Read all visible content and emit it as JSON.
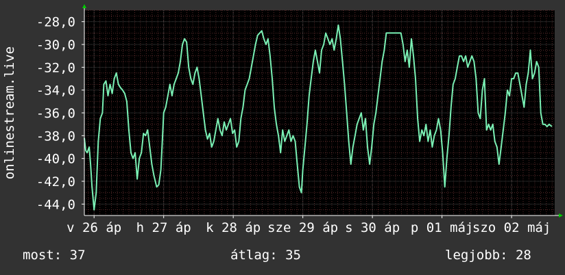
{
  "chart_data": {
    "type": "line",
    "ylabel": "onlinestream.live",
    "ylim": [
      -45,
      -27
    ],
    "y_ticks": [
      "-28,0",
      "-30,0",
      "-32,0",
      "-34,0",
      "-36,0",
      "-38,0",
      "-40,0",
      "-42,0",
      "-44,0"
    ],
    "y_tick_values": [
      -28,
      -30,
      -32,
      -34,
      -36,
      -38,
      -40,
      -42,
      -44
    ],
    "x_ticks": [
      "v 26 áp",
      "h 27 áp",
      "k 28 áp",
      "sze 29 áp",
      "s 30 áp",
      "p 01 máj",
      "szo 02 máj"
    ],
    "x_tick_values": [
      0,
      1,
      2,
      3,
      4,
      5,
      6
    ],
    "xlim": [
      -0.14,
      6.62
    ],
    "grid": true,
    "colors": {
      "background": "#000000",
      "frame": "#323232",
      "grid_major": "#3a3a3a",
      "grid_minor": "#5a2a2a",
      "line": "#7af0b4",
      "axis": "#ffffff",
      "arrow": "#00cc00"
    },
    "series": [
      {
        "values": [
          [
            -0.14,
            -38.2
          ],
          [
            -0.12,
            -39.3
          ],
          [
            -0.1,
            -39.5
          ],
          [
            -0.07,
            -39.0
          ],
          [
            -0.05,
            -40.5
          ],
          [
            -0.03,
            -42.5
          ],
          [
            0.0,
            -44.5
          ],
          [
            0.03,
            -43.0
          ],
          [
            0.06,
            -38.5
          ],
          [
            0.09,
            -36.5
          ],
          [
            0.12,
            -36.0
          ],
          [
            0.14,
            -33.5
          ],
          [
            0.17,
            -33.2
          ],
          [
            0.2,
            -34.5
          ],
          [
            0.23,
            -33.5
          ],
          [
            0.26,
            -34.3
          ],
          [
            0.29,
            -33.0
          ],
          [
            0.32,
            -32.5
          ],
          [
            0.35,
            -33.5
          ],
          [
            0.38,
            -33.8
          ],
          [
            0.41,
            -34.0
          ],
          [
            0.44,
            -34.3
          ],
          [
            0.47,
            -35.0
          ],
          [
            0.5,
            -37.5
          ],
          [
            0.53,
            -39.5
          ],
          [
            0.56,
            -40.0
          ],
          [
            0.59,
            -39.5
          ],
          [
            0.62,
            -41.8
          ],
          [
            0.65,
            -40.0
          ],
          [
            0.68,
            -39.5
          ],
          [
            0.71,
            -37.8
          ],
          [
            0.74,
            -38.0
          ],
          [
            0.77,
            -37.5
          ],
          [
            0.8,
            -39.0
          ],
          [
            0.83,
            -40.5
          ],
          [
            0.86,
            -41.5
          ],
          [
            0.9,
            -42.5
          ],
          [
            0.93,
            -42.3
          ],
          [
            0.96,
            -41.0
          ],
          [
            0.98,
            -38.5
          ],
          [
            1.0,
            -36.0
          ],
          [
            1.03,
            -35.5
          ],
          [
            1.06,
            -34.5
          ],
          [
            1.09,
            -33.5
          ],
          [
            1.12,
            -34.5
          ],
          [
            1.15,
            -33.5
          ],
          [
            1.18,
            -33.0
          ],
          [
            1.21,
            -32.5
          ],
          [
            1.24,
            -31.5
          ],
          [
            1.27,
            -30.0
          ],
          [
            1.3,
            -29.5
          ],
          [
            1.33,
            -29.8
          ],
          [
            1.36,
            -32.0
          ],
          [
            1.39,
            -33.0
          ],
          [
            1.42,
            -33.5
          ],
          [
            1.45,
            -32.5
          ],
          [
            1.48,
            -32.0
          ],
          [
            1.51,
            -33.0
          ],
          [
            1.54,
            -34.5
          ],
          [
            1.57,
            -36.0
          ],
          [
            1.6,
            -37.5
          ],
          [
            1.63,
            -38.3
          ],
          [
            1.66,
            -37.8
          ],
          [
            1.69,
            -39.0
          ],
          [
            1.72,
            -38.5
          ],
          [
            1.75,
            -37.5
          ],
          [
            1.78,
            -36.5
          ],
          [
            1.81,
            -37.5
          ],
          [
            1.84,
            -38.0
          ],
          [
            1.87,
            -36.8
          ],
          [
            1.9,
            -37.5
          ],
          [
            1.93,
            -37.0
          ],
          [
            1.96,
            -36.5
          ],
          [
            1.99,
            -37.8
          ],
          [
            2.02,
            -37.5
          ],
          [
            2.05,
            -39.0
          ],
          [
            2.08,
            -38.5
          ],
          [
            2.11,
            -36.5
          ],
          [
            2.14,
            -35.5
          ],
          [
            2.17,
            -34.0
          ],
          [
            2.2,
            -33.5
          ],
          [
            2.23,
            -33.0
          ],
          [
            2.26,
            -32.0
          ],
          [
            2.29,
            -31.0
          ],
          [
            2.32,
            -30.0
          ],
          [
            2.35,
            -29.2
          ],
          [
            2.38,
            -29.0
          ],
          [
            2.41,
            -28.8
          ],
          [
            2.44,
            -29.5
          ],
          [
            2.47,
            -30.0
          ],
          [
            2.5,
            -29.5
          ],
          [
            2.53,
            -31.0
          ],
          [
            2.56,
            -33.0
          ],
          [
            2.59,
            -35.5
          ],
          [
            2.62,
            -37.0
          ],
          [
            2.65,
            -38.0
          ],
          [
            2.68,
            -39.5
          ],
          [
            2.71,
            -37.5
          ],
          [
            2.74,
            -38.5
          ],
          [
            2.77,
            -38.0
          ],
          [
            2.8,
            -37.5
          ],
          [
            2.83,
            -38.5
          ],
          [
            2.86,
            -38.0
          ],
          [
            2.89,
            -38.5
          ],
          [
            2.92,
            -40.5
          ],
          [
            2.95,
            -42.5
          ],
          [
            2.98,
            -43.0
          ],
          [
            3.0,
            -41.0
          ],
          [
            3.03,
            -39.0
          ],
          [
            3.06,
            -37.0
          ],
          [
            3.09,
            -34.5
          ],
          [
            3.12,
            -33.0
          ],
          [
            3.15,
            -31.5
          ],
          [
            3.18,
            -30.5
          ],
          [
            3.21,
            -31.5
          ],
          [
            3.24,
            -32.5
          ],
          [
            3.27,
            -30.5
          ],
          [
            3.3,
            -30.0
          ],
          [
            3.33,
            -29.0
          ],
          [
            3.36,
            -29.5
          ],
          [
            3.39,
            -30.0
          ],
          [
            3.42,
            -29.5
          ],
          [
            3.45,
            -30.5
          ],
          [
            3.48,
            -29.5
          ],
          [
            3.51,
            -28.3
          ],
          [
            3.54,
            -29.5
          ],
          [
            3.57,
            -31.5
          ],
          [
            3.6,
            -33.5
          ],
          [
            3.63,
            -36.0
          ],
          [
            3.66,
            -38.5
          ],
          [
            3.69,
            -40.5
          ],
          [
            3.72,
            -39.0
          ],
          [
            3.75,
            -38.0
          ],
          [
            3.78,
            -37.0
          ],
          [
            3.81,
            -36.5
          ],
          [
            3.84,
            -36.0
          ],
          [
            3.87,
            -37.5
          ],
          [
            3.9,
            -36.5
          ],
          [
            3.93,
            -39.0
          ],
          [
            3.96,
            -40.5
          ],
          [
            3.99,
            -39.0
          ],
          [
            4.02,
            -37.0
          ],
          [
            4.05,
            -36.0
          ],
          [
            4.08,
            -34.5
          ],
          [
            4.11,
            -33.0
          ],
          [
            4.14,
            -31.5
          ],
          [
            4.17,
            -30.5
          ],
          [
            4.2,
            -29.0
          ],
          [
            4.23,
            -29.0
          ],
          [
            4.26,
            -29.0
          ],
          [
            4.29,
            -29.0
          ],
          [
            4.32,
            -29.0
          ],
          [
            4.35,
            -29.0
          ],
          [
            4.38,
            -29.0
          ],
          [
            4.41,
            -29.0
          ],
          [
            4.44,
            -30.0
          ],
          [
            4.47,
            -31.5
          ],
          [
            4.5,
            -30.5
          ],
          [
            4.53,
            -32.0
          ],
          [
            4.56,
            -29.5
          ],
          [
            4.59,
            -31.0
          ],
          [
            4.62,
            -33.0
          ],
          [
            4.65,
            -36.5
          ],
          [
            4.68,
            -38.5
          ],
          [
            4.71,
            -37.5
          ],
          [
            4.74,
            -38.0
          ],
          [
            4.77,
            -37.0
          ],
          [
            4.8,
            -38.5
          ],
          [
            4.83,
            -37.5
          ],
          [
            4.86,
            -39.0
          ],
          [
            4.89,
            -38.0
          ],
          [
            4.92,
            -37.5
          ],
          [
            4.95,
            -36.5
          ],
          [
            4.98,
            -37.5
          ],
          [
            5.01,
            -39.5
          ],
          [
            5.04,
            -42.5
          ],
          [
            5.07,
            -40.0
          ],
          [
            5.1,
            -38.0
          ],
          [
            5.13,
            -35.5
          ],
          [
            5.16,
            -33.5
          ],
          [
            5.19,
            -33.0
          ],
          [
            5.22,
            -32.0
          ],
          [
            5.25,
            -31.0
          ],
          [
            5.28,
            -31.0
          ],
          [
            5.31,
            -31.5
          ],
          [
            5.34,
            -31.0
          ],
          [
            5.37,
            -32.0
          ],
          [
            5.4,
            -31.5
          ],
          [
            5.43,
            -31.0
          ],
          [
            5.46,
            -31.5
          ],
          [
            5.49,
            -33.0
          ],
          [
            5.52,
            -36.0
          ],
          [
            5.55,
            -36.5
          ],
          [
            5.58,
            -34.0
          ],
          [
            5.61,
            -33.0
          ],
          [
            5.64,
            -37.5
          ],
          [
            5.67,
            -37.0
          ],
          [
            5.7,
            -37.5
          ],
          [
            5.73,
            -37.0
          ],
          [
            5.76,
            -38.5
          ],
          [
            5.79,
            -39.0
          ],
          [
            5.82,
            -40.5
          ],
          [
            5.85,
            -39.0
          ],
          [
            5.88,
            -37.5
          ],
          [
            5.91,
            -36.0
          ],
          [
            5.94,
            -34.0
          ],
          [
            5.97,
            -34.5
          ],
          [
            6.0,
            -33.0
          ],
          [
            6.03,
            -33.0
          ],
          [
            6.06,
            -32.5
          ],
          [
            6.09,
            -32.5
          ],
          [
            6.12,
            -33.5
          ],
          [
            6.15,
            -34.5
          ],
          [
            6.18,
            -35.5
          ],
          [
            6.21,
            -33.5
          ],
          [
            6.24,
            -32.5
          ],
          [
            6.27,
            -30.5
          ],
          [
            6.3,
            -33.0
          ],
          [
            6.33,
            -32.5
          ],
          [
            6.36,
            -31.5
          ],
          [
            6.39,
            -32.0
          ],
          [
            6.42,
            -36.0
          ],
          [
            6.45,
            -37.0
          ],
          [
            6.48,
            -37.0
          ],
          [
            6.51,
            -37.2
          ],
          [
            6.54,
            -37.0
          ],
          [
            6.58,
            -37.2
          ]
        ]
      }
    ]
  },
  "legend_footer": {
    "most_label": "most:",
    "most_value": "37",
    "avg_label": "átlag:",
    "avg_value": "35",
    "best_label": "legjobb:",
    "best_value": "28"
  }
}
